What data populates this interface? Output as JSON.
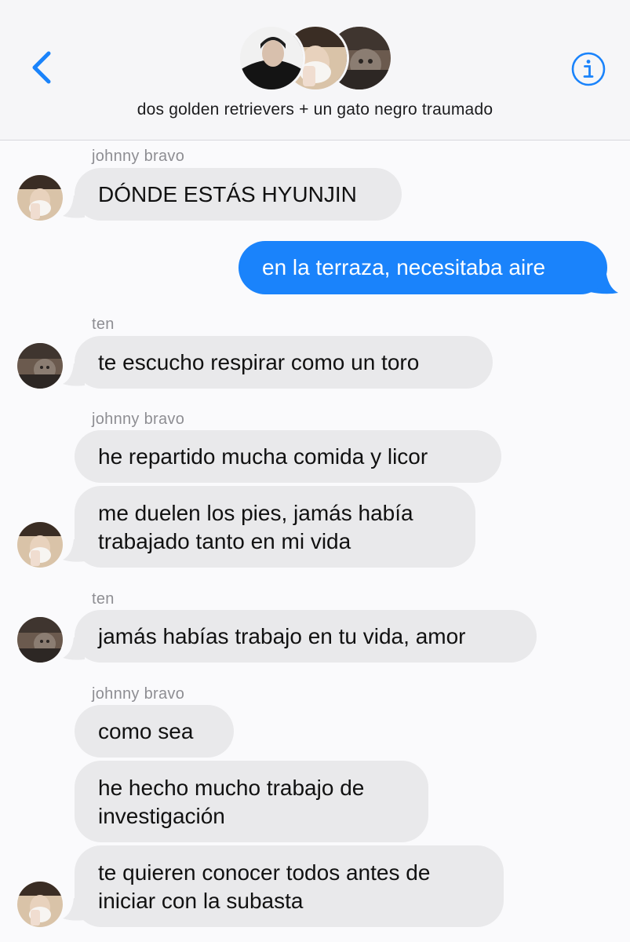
{
  "header": {
    "group_name": "dos golden retrievers + un gato negro traumado",
    "back_icon": "chevron-left-icon",
    "info_icon": "info-icon",
    "accent_color": "#1a83fb"
  },
  "messages": [
    {
      "sender": "johnny bravo",
      "text": "DÓNDE ESTÁS HYUNJIN",
      "outgoing": false
    },
    {
      "sender": "",
      "text": "en la terraza, necesitaba aire",
      "outgoing": true
    },
    {
      "sender": "ten",
      "text": "te escucho respirar como un toro",
      "outgoing": false
    },
    {
      "sender": "johnny bravo",
      "text": "he repartido mucha comida y licor",
      "outgoing": false
    },
    {
      "sender": "",
      "text": "me duelen los pies, jamás había trabajado tanto en mi vida",
      "outgoing": false
    },
    {
      "sender": "ten",
      "text": "jamás habías trabajo en tu vida, amor",
      "outgoing": false
    },
    {
      "sender": "johnny bravo",
      "text": "como sea",
      "outgoing": false
    },
    {
      "sender": "",
      "text": "he hecho mucho trabajo de investigación",
      "outgoing": false
    },
    {
      "sender": "",
      "text": "te quieren conocer todos antes de iniciar con la subasta",
      "outgoing": false
    }
  ],
  "colors": {
    "incoming_bubble": "#e9e9eb",
    "outgoing_bubble": "#1a83fb",
    "sender_label": "#8e8e93"
  }
}
